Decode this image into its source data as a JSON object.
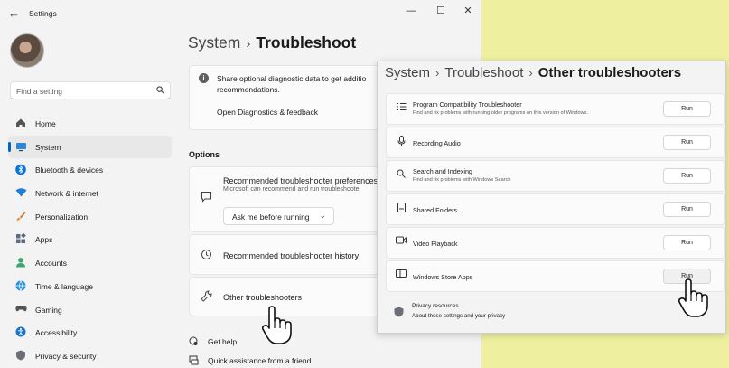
{
  "window": {
    "title": "Settings",
    "back_glyph": "←",
    "minimize_glyph": "—",
    "maximize_glyph": "☐",
    "close_glyph": "✕"
  },
  "search": {
    "placeholder": "Find a setting"
  },
  "sidebar": {
    "items": [
      {
        "label": "Home",
        "icon": "home-icon",
        "active": false
      },
      {
        "label": "System",
        "icon": "system-icon",
        "active": true
      },
      {
        "label": "Bluetooth & devices",
        "icon": "bluetooth-icon",
        "active": false
      },
      {
        "label": "Network & internet",
        "icon": "network-icon",
        "active": false
      },
      {
        "label": "Personalization",
        "icon": "brush-icon",
        "active": false
      },
      {
        "label": "Apps",
        "icon": "apps-icon",
        "active": false
      },
      {
        "label": "Accounts",
        "icon": "accounts-icon",
        "active": false
      },
      {
        "label": "Time & language",
        "icon": "time-language-icon",
        "active": false
      },
      {
        "label": "Gaming",
        "icon": "gaming-icon",
        "active": false
      },
      {
        "label": "Accessibility",
        "icon": "accessibility-icon",
        "active": false
      },
      {
        "label": "Privacy & security",
        "icon": "shield-icon",
        "active": false
      }
    ]
  },
  "main": {
    "breadcrumb": {
      "parent": "System",
      "current": "Troubleshoot",
      "separator": "›"
    },
    "diagnostics": {
      "text_line1": "Share optional diagnostic data to get additio",
      "text_line2": "recommendations.",
      "link": "Open Diagnostics & feedback"
    },
    "options_label": "Options",
    "recommended": {
      "title": "Recommended troubleshooter preferences",
      "desc": "Microsoft can recommend and run troubleshoote",
      "dropdown_value": "Ask me before running"
    },
    "history_label": "Recommended troubleshooter history",
    "other_label": "Other troubleshooters",
    "links": [
      {
        "label": "Get help",
        "icon": "help-icon"
      },
      {
        "label": "Quick assistance from a friend",
        "icon": "quick-assist-icon"
      }
    ]
  },
  "panel": {
    "breadcrumb": {
      "c1": "System",
      "c2": "Troubleshoot",
      "c3": "Other troubleshooters",
      "separator": "›"
    },
    "run_label": "Run",
    "rows": [
      {
        "title": "Program Compatibility Troubleshooter",
        "desc": "Find and fix problems with running older programs on this version of Windows.",
        "icon": "program-compat-icon"
      },
      {
        "title": "Recording Audio",
        "desc": "",
        "icon": "microphone-icon"
      },
      {
        "title": "Search and Indexing",
        "desc": "Find and fix problems with Windows Search",
        "icon": "search-icon"
      },
      {
        "title": "Shared Folders",
        "desc": "",
        "icon": "shared-folder-icon"
      },
      {
        "title": "Video Playback",
        "desc": "",
        "icon": "video-icon"
      },
      {
        "title": "Windows Store Apps",
        "desc": "",
        "icon": "store-apps-icon"
      }
    ],
    "privacy": {
      "title": "Privacy resources",
      "link": "About these settings and your privacy"
    }
  },
  "colors": {
    "accent": "#0067c0",
    "background": "#eef0a0",
    "window": "#f3f3f3",
    "card": "#fbfbfb"
  }
}
